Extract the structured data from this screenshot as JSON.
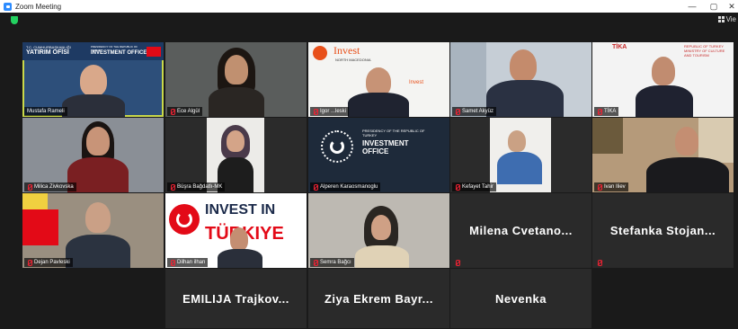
{
  "window": {
    "title": "Zoom Meeting",
    "view_label": "Vie"
  },
  "colors": {
    "active_speaker_border": "#c9d94a",
    "muted_icon": "#e22233",
    "security_shield": "#23d160"
  },
  "participants": [
    {
      "name": "Mustafa Rameli",
      "muted": false,
      "active": true,
      "backdrop_text": [
        "T.C. CUMHURBAŞKANLIĞI",
        "YATIRIM OFİSİ",
        "PRESIDENCY OF THE REPUBLIC OF TURKEY",
        "INVESTMENT OFFICE"
      ]
    },
    {
      "name": "Ece Algül",
      "muted": true
    },
    {
      "name": "Igor ...leski",
      "muted": true,
      "backdrop_text": [
        "Invest",
        "NORTH MACEDONIA",
        "Invest"
      ]
    },
    {
      "name": "Samet Akyüz",
      "muted": true
    },
    {
      "name": "TİKA",
      "muted": true,
      "backdrop_text": [
        "TİKA",
        "REPUBLIC OF TURKEY MINISTRY OF CULTURE AND TOURISM"
      ]
    },
    {
      "name": "Milica Zivkovska",
      "muted": true
    },
    {
      "name": "Büşra Bağdatlı-MK",
      "muted": true
    },
    {
      "name": "Alperen Karaosmanoglu",
      "muted": true,
      "backdrop_text": [
        "PRESIDENCY OF THE REPUBLIC OF TURKEY",
        "INVESTMENT OFFICE"
      ]
    },
    {
      "name": "Kefayet Tahir",
      "muted": true
    },
    {
      "name": "Ivan Iliev",
      "muted": true
    },
    {
      "name": "Dejan Pavleski",
      "muted": true
    },
    {
      "name": "Dilhan ilhan",
      "muted": true,
      "backdrop_text": [
        "INVEST IN",
        "TÜRKIYE"
      ]
    },
    {
      "name": "Semra Bağcı",
      "muted": true
    },
    {
      "name": "Milena Cvetano...",
      "muted": true,
      "video_off": true
    },
    {
      "name": "Stefanka Stojan...",
      "muted": true,
      "video_off": true
    },
    {
      "name": "EMILIJA Trajkov...",
      "muted": false,
      "video_off": true
    },
    {
      "name": "Ziya Ekrem Bayr...",
      "muted": false,
      "video_off": true
    },
    {
      "name": "Nevenka",
      "muted": false,
      "video_off": true
    }
  ]
}
